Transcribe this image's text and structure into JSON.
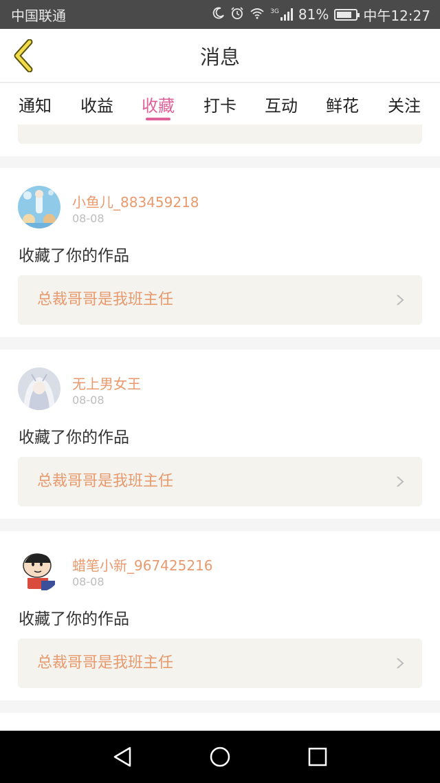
{
  "status_bar": {
    "carrier": "中国联通",
    "network": "3G",
    "battery": "81%",
    "battery_level": 0.81,
    "time": "中午12:27",
    "icons": [
      "moon-icon",
      "alarm-icon",
      "wifi-icon",
      "signal-icon",
      "battery-icon"
    ]
  },
  "header": {
    "title": "消息",
    "back_icon": "chevron-left-icon",
    "accent": "#e0609a"
  },
  "tabs": [
    {
      "label": "通知",
      "active": false
    },
    {
      "label": "收益",
      "active": false
    },
    {
      "label": "收藏",
      "active": true
    },
    {
      "label": "打卡",
      "active": false
    },
    {
      "label": "互动",
      "active": false
    },
    {
      "label": "鲜花",
      "active": false
    },
    {
      "label": "关注",
      "active": false
    }
  ],
  "items": [
    {
      "username": "小鱼儿_883459218",
      "date": "08-08",
      "message": "收藏了你的作品",
      "work_title": "总裁哥哥是我班主任"
    },
    {
      "username": "无上男女王",
      "date": "08-08",
      "message": "收藏了你的作品",
      "work_title": "总裁哥哥是我班主任"
    },
    {
      "username": "蜡笔小新_967425216",
      "date": "08-08",
      "message": "收藏了你的作品",
      "work_title": "总裁哥哥是我班主任"
    }
  ],
  "colors": {
    "username": "#e89a6e",
    "link_bg": "#f4f3ee",
    "status_bar_bg": "#4a4a4a",
    "nav_bar_bg": "#000000"
  }
}
